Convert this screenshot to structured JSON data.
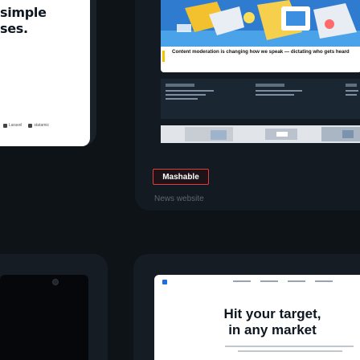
{
  "top_left": {
    "headline_line1": "simple",
    "headline_line2": "ses.",
    "logos": [
      {
        "icon": "laravel-icon",
        "label": "Laravel"
      },
      {
        "icon": "statamic-icon",
        "label": "statamic"
      }
    ]
  },
  "top_right": {
    "article_caption": "Content moderation is changing how we speak — dictating who gets heard",
    "project_name": "Mashable",
    "project_type": "News website"
  },
  "bottom_right": {
    "hero_line1": "Hit your target,",
    "hero_line2": "in any market"
  },
  "colors": {
    "background": "#0e1318",
    "badge_border": "#e33b3b",
    "muted_text": "#5c6673"
  }
}
